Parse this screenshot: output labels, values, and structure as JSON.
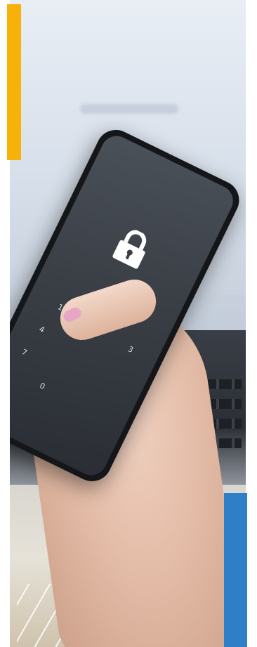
{
  "phone": {
    "keypad_digits": [
      "1",
      "4",
      "7",
      "0",
      "3"
    ]
  },
  "colors": {
    "accent_yellow": "#f6b10a",
    "accent_blue": "#2f7fc8"
  },
  "icons": [
    "lock-icon"
  ]
}
